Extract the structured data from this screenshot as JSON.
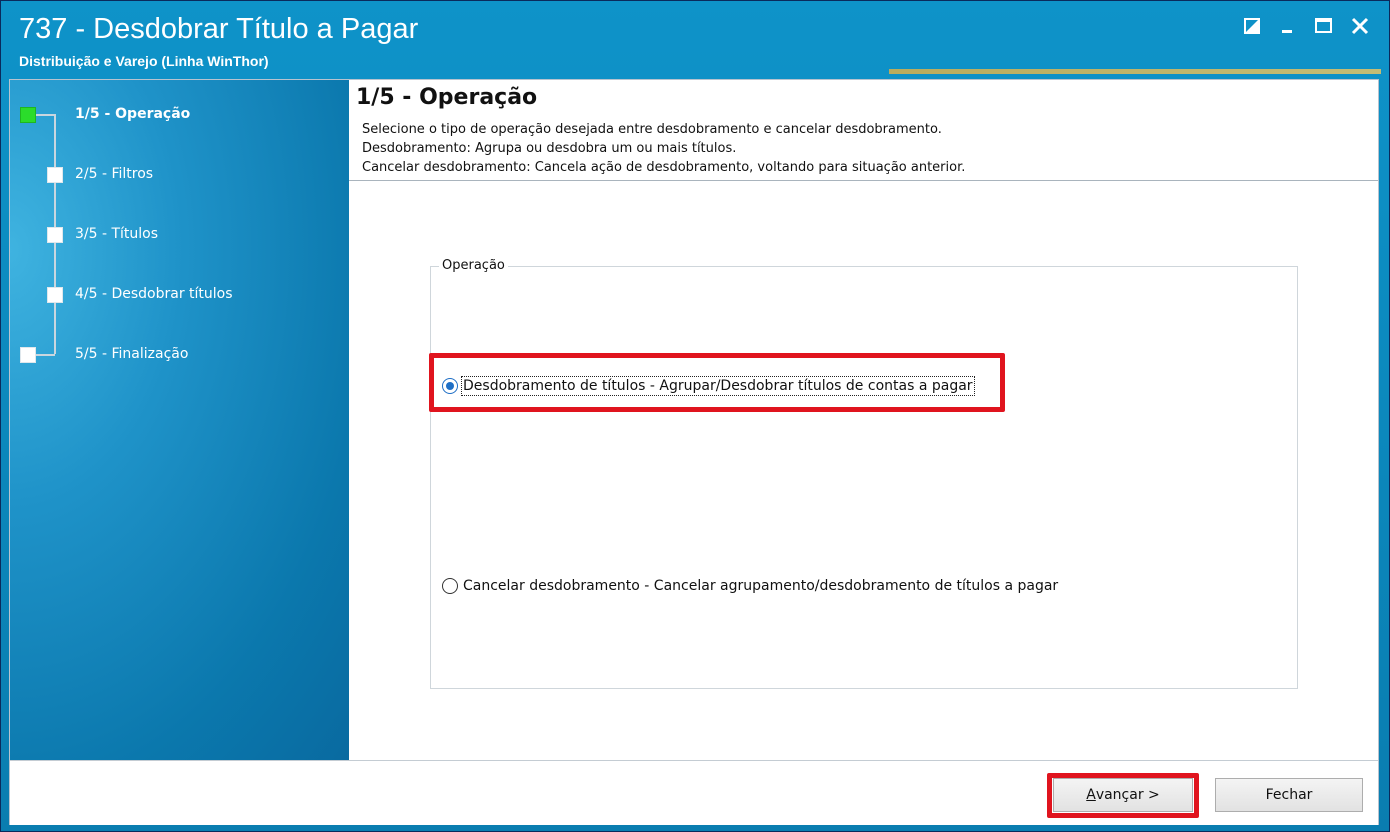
{
  "window": {
    "title": "737 - Desdobrar Título a Pagar",
    "subtitle": "Distribuição e Varejo (Linha WinThor)",
    "controls": [
      "restore-icon",
      "minimize-icon",
      "maximize-icon",
      "close-icon"
    ]
  },
  "steps": [
    {
      "label": "1/5 - Operação",
      "active": true
    },
    {
      "label": "2/5 - Filtros",
      "active": false
    },
    {
      "label": "3/5 - Títulos",
      "active": false
    },
    {
      "label": "4/5 - Desdobrar títulos",
      "active": false
    },
    {
      "label": "5/5 - Finalização",
      "active": false
    }
  ],
  "header": {
    "title": "1/5 - Operação",
    "lines": [
      "Selecione o tipo de operação desejada entre desdobramento e cancelar desdobramento.",
      "Desdobramento: Agrupa ou desdobra um ou mais títulos.",
      "Cancelar desdobramento: Cancela ação de desdobramento, voltando para situação anterior."
    ]
  },
  "operation_group": {
    "legend": "Operação",
    "options": [
      {
        "label": "Desdobramento de títulos - Agrupar/Desdobrar títulos de contas a pagar",
        "checked": true
      },
      {
        "label": "Cancelar desdobramento - Cancelar agrupamento/desdobramento de títulos a pagar",
        "checked": false
      }
    ]
  },
  "footer": {
    "next_accel": "A",
    "next_rest": "vançar >",
    "close_label": "Fechar"
  },
  "colors": {
    "highlight": "#e0141e",
    "active_step": "#2bdc2b",
    "title_bar": "#0e93c9"
  }
}
